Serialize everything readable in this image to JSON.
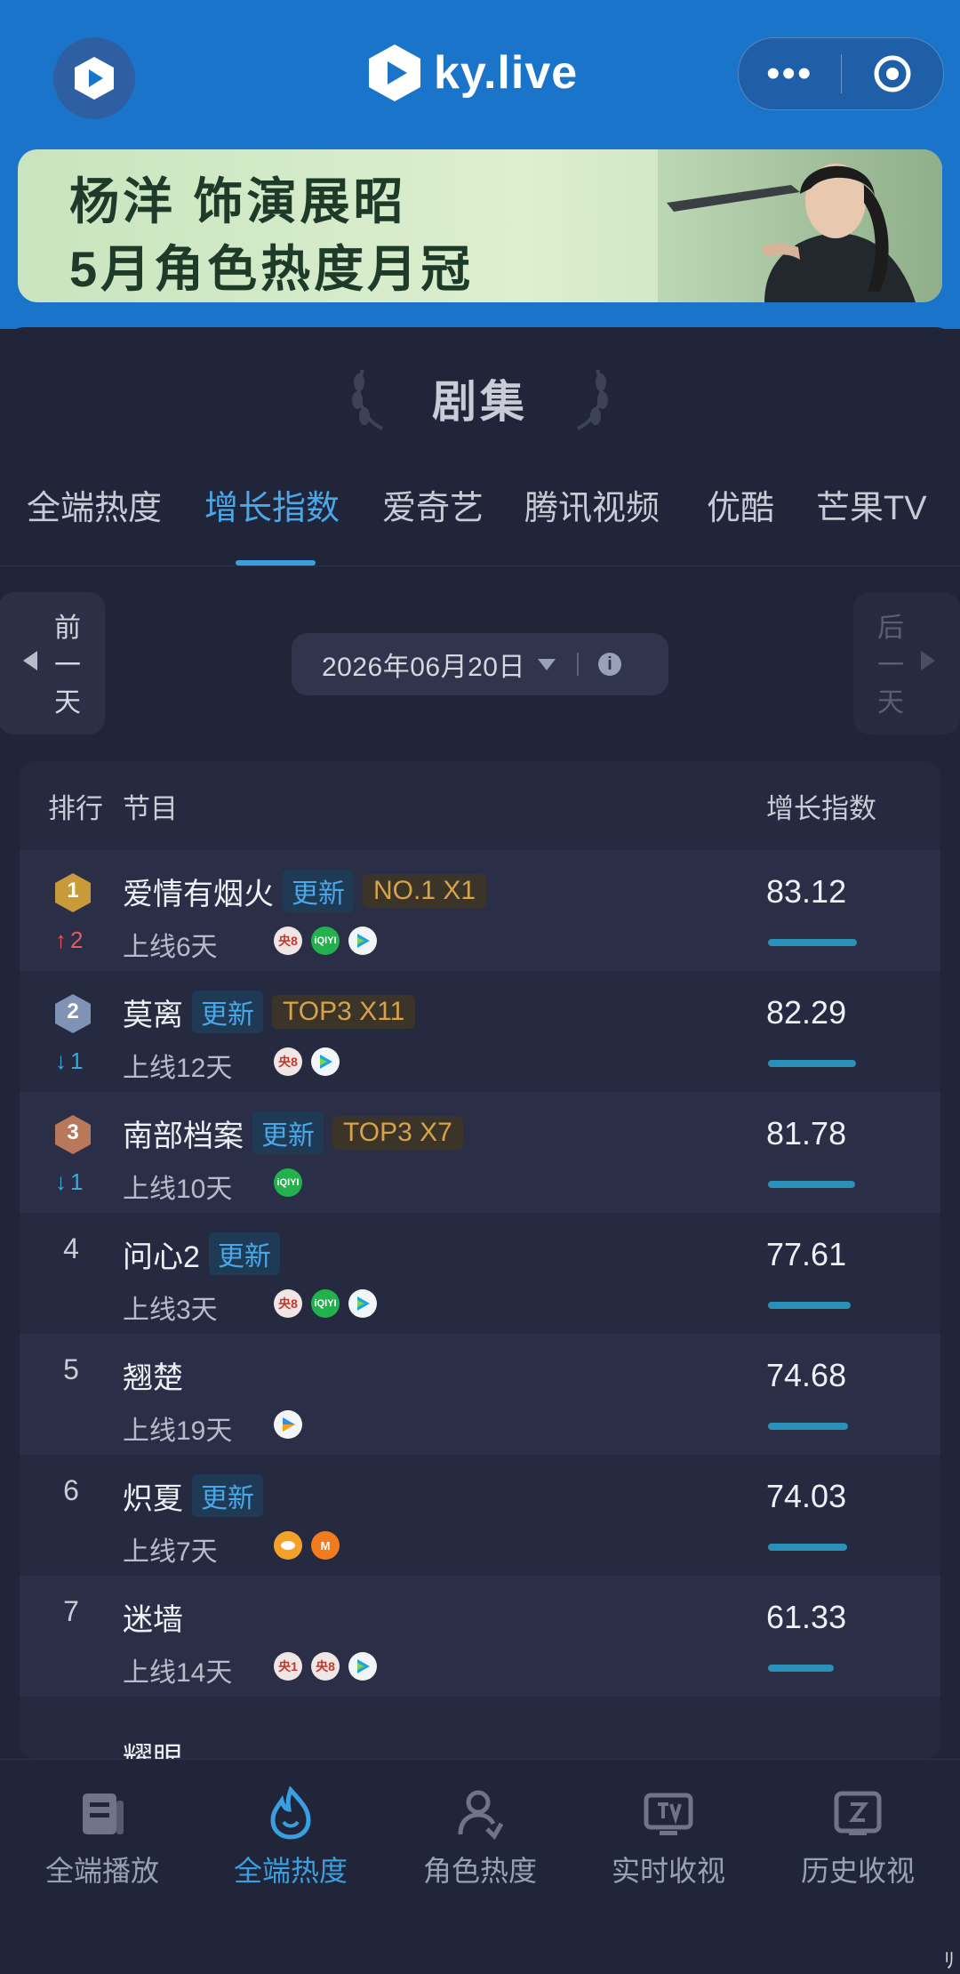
{
  "header": {
    "brand": "ky.live",
    "more_icon": "more-dots-icon",
    "close_icon": "target-icon"
  },
  "banner": {
    "line1": "杨洋 饰演展昭",
    "line2": "5月角色热度月冠"
  },
  "panel": {
    "title": "剧集"
  },
  "tabs": [
    "全端热度",
    "增长指数",
    "爱奇艺",
    "腾讯视频",
    "优酷",
    "芒果TV"
  ],
  "active_tab": 1,
  "date_nav": {
    "prev_label": "前一天",
    "next_label": "后一天",
    "date": "2026年06月20日"
  },
  "table": {
    "headers": {
      "rank": "排行",
      "program": "节目",
      "index": "增长指数"
    },
    "rows": [
      {
        "rank": "1",
        "change": "2",
        "title": "爱情有烟火",
        "update": "更新",
        "top": "NO.1 X1",
        "online": "上线6天",
        "platforms": [
          "央8",
          "爱奇艺",
          "腾讯视频"
        ],
        "score": "83.12",
        "score_value": 83.12
      },
      {
        "rank": "2",
        "change": "1",
        "title": "莫离",
        "update": "更新",
        "top": "TOP3 X11",
        "online": "上线12天",
        "platforms": [
          "央8",
          "腾讯视频"
        ],
        "score": "82.29",
        "score_value": 82.29
      },
      {
        "rank": "3",
        "change": "1",
        "title": "南部档案",
        "update": "更新",
        "top": "TOP3 X7",
        "online": "上线10天",
        "platforms": [
          "爱奇艺"
        ],
        "score": "81.78",
        "score_value": 81.78
      },
      {
        "rank": "4",
        "change": "",
        "title": "问心2",
        "update": "更新",
        "top": "",
        "online": "上线3天",
        "platforms": [
          "央8",
          "爱奇艺",
          "腾讯视频"
        ],
        "score": "77.61",
        "score_value": 77.61
      },
      {
        "rank": "5",
        "change": "",
        "title": "翘楚",
        "update": "",
        "top": "",
        "online": "上线19天",
        "platforms": [
          "优酷"
        ],
        "score": "74.68",
        "score_value": 74.68
      },
      {
        "rank": "6",
        "change": "",
        "title": "炽夏",
        "update": "更新",
        "top": "",
        "online": "上线7天",
        "platforms": [
          "芒果TV",
          "芒果TV"
        ],
        "score": "74.03",
        "score_value": 74.03
      },
      {
        "rank": "7",
        "change": "",
        "title": "迷墙",
        "update": "",
        "top": "",
        "online": "上线14天",
        "platforms": [
          "央1",
          "央8",
          "腾讯视频"
        ],
        "score": "61.33",
        "score_value": 61.33
      }
    ],
    "partial_row_title": "耀眼"
  },
  "platform_labels": {
    "cctv8": "央8",
    "cctv1": "央1",
    "iqiyi": "iQIYI",
    "mgtv": "M"
  },
  "bottom_nav": [
    {
      "label": "全端播放",
      "icon": "playback-icon"
    },
    {
      "label": "全端热度",
      "icon": "flame-icon"
    },
    {
      "label": "角色热度",
      "icon": "person-icon"
    },
    {
      "label": "实时收视",
      "icon": "tv-icon"
    },
    {
      "label": "历史收视",
      "icon": "history-icon"
    }
  ],
  "colors": {
    "header_blue": "#1a74c9",
    "background": "#21253a",
    "accent_blue": "#3b9ee0",
    "gold": "#d7a24a",
    "bar": "#2a92b8",
    "up_red": "#e85a5a",
    "down_blue": "#3aa8d8"
  },
  "corner_mark": "ﾘ"
}
